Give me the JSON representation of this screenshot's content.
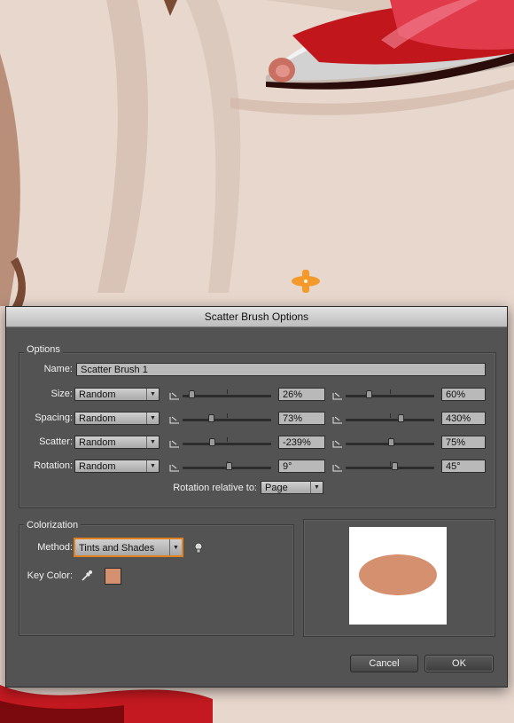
{
  "dialog": {
    "title": "Scatter Brush Options",
    "options_group": "Options",
    "name_label": "Name:",
    "name_value": "Scatter Brush 1",
    "rows": [
      {
        "label": "Size:",
        "mode": "Random",
        "min_value": "26%",
        "max_value": "60%",
        "min_level": 0.1,
        "max_level": 0.26
      },
      {
        "label": "Spacing:",
        "mode": "Random",
        "min_value": "73%",
        "max_value": "430%",
        "min_level": 0.32,
        "max_level": 0.62
      },
      {
        "label": "Scatter:",
        "mode": "Random",
        "min_value": "-239%",
        "max_value": "75%",
        "min_level": 0.33,
        "max_level": 0.51
      },
      {
        "label": "Rotation:",
        "mode": "Random",
        "min_value": "9°",
        "max_value": "45°",
        "min_level": 0.52,
        "max_level": 0.55
      }
    ],
    "rotation_relative_label": "Rotation relative to:",
    "rotation_relative_value": "Page",
    "colorization_group": "Colorization",
    "method_label": "Method:",
    "method_value": "Tints and Shades",
    "key_color_label": "Key Color:",
    "key_color": "#d4906f",
    "preview_fill": "#d4906f",
    "cancel_label": "Cancel",
    "ok_label": "OK"
  },
  "colors": {
    "dialog_bg": "#535353",
    "accent_focus": "#e0801f",
    "handle": "#f39a2a"
  },
  "icons": [
    "lock-icon",
    "dropdown-arrow-icon",
    "lightbulb-tip-icon",
    "eyedropper-icon"
  ]
}
